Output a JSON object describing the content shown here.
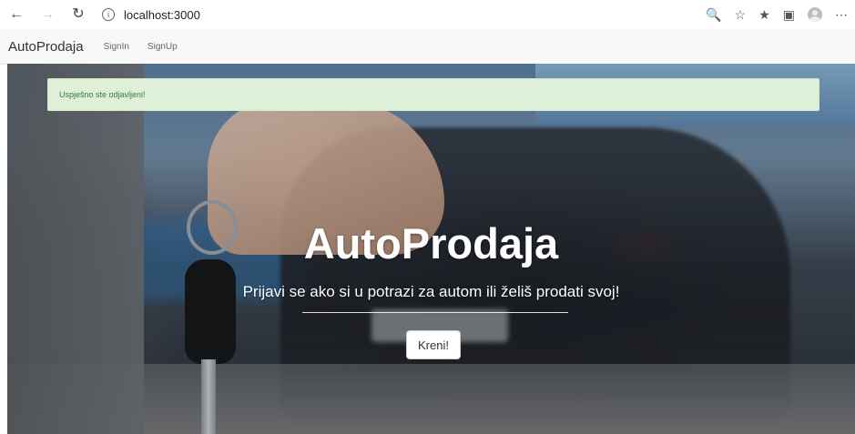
{
  "browser": {
    "url": "localhost:3000",
    "icons": [
      "back-icon",
      "forward-icon",
      "refresh-icon",
      "info-icon",
      "zoom-icon",
      "favorite-icon",
      "favorites-list-icon",
      "collections-icon",
      "profile-icon",
      "more-icon"
    ]
  },
  "navbar": {
    "brand": "AutoProdaja",
    "links": [
      "SignIn",
      "SignUp"
    ]
  },
  "alert": {
    "message": "Uspješno ste odjavljeni!"
  },
  "hero": {
    "title": "AutoProdaja",
    "subtitle": "Prijavi se ako si u potrazi za autom ili želiš prodati svoj!",
    "button_label": "Kreni!"
  },
  "colors": {
    "alert_bg": "#dff0d8",
    "alert_text": "#3c763d",
    "navbar_bg": "#f8f8f8"
  }
}
